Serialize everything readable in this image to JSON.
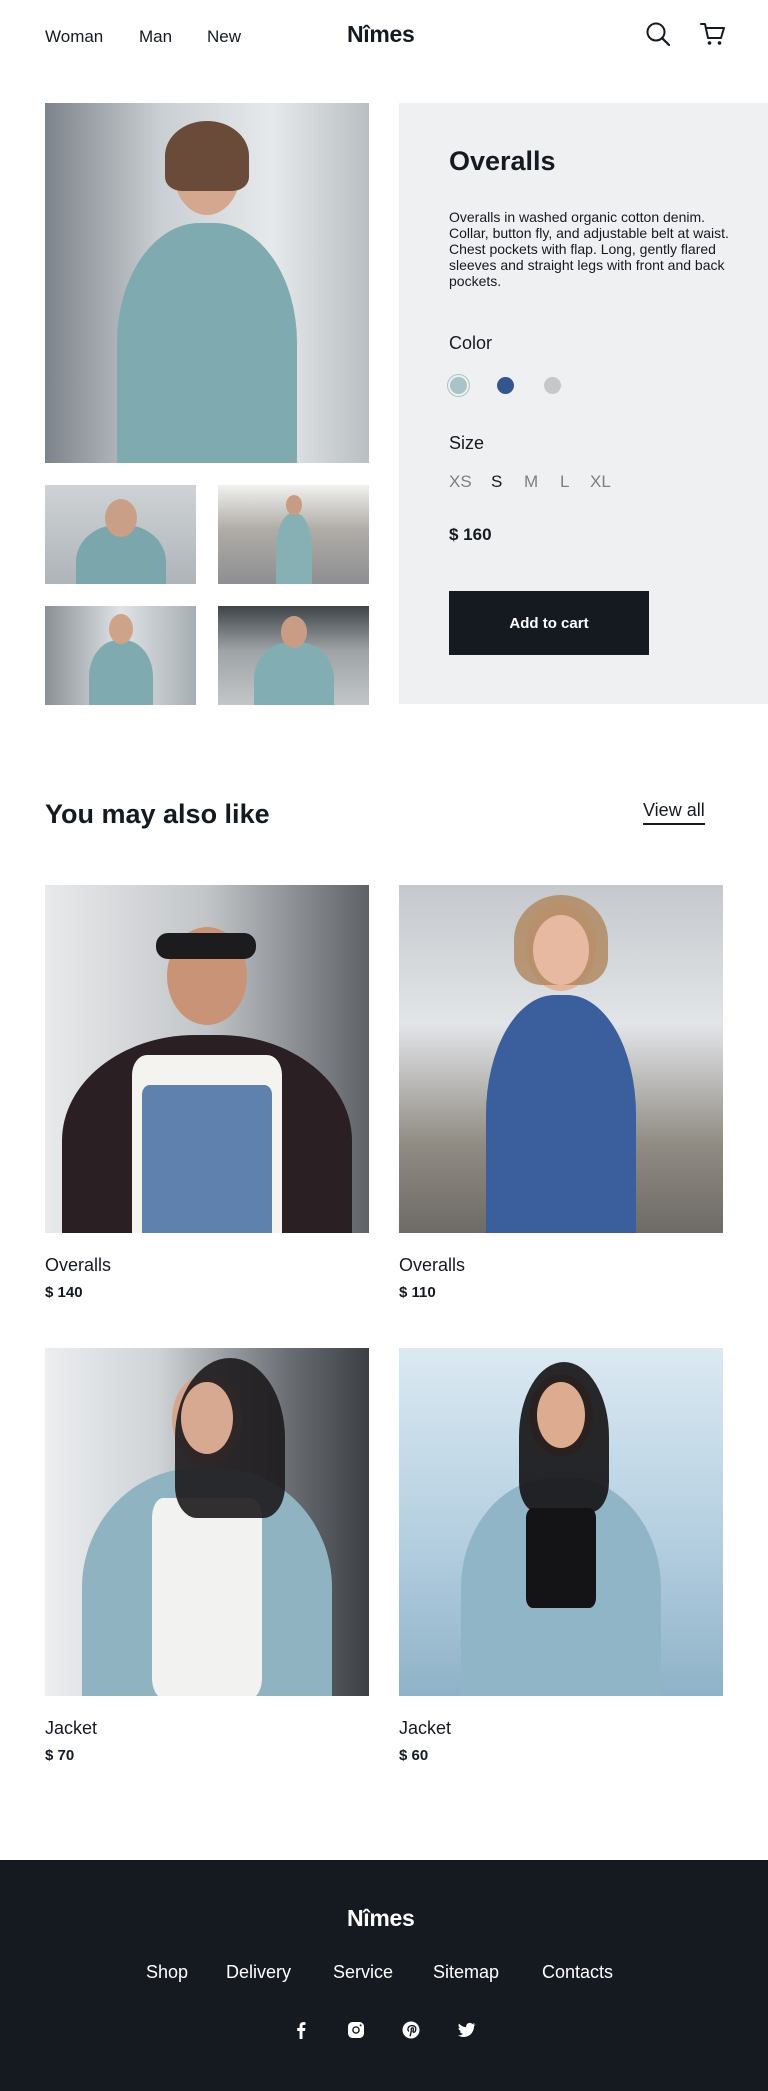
{
  "header": {
    "nav": [
      {
        "label": "Woman"
      },
      {
        "label": "Man"
      },
      {
        "label": "New"
      }
    ],
    "logo": "Nîmes",
    "icons": [
      "search-icon",
      "cart-icon"
    ]
  },
  "product": {
    "title": "Overalls",
    "description": "Overalls in washed organic cotton denim. Collar, button fly, and adjustable belt at waist. Chest pockets with flap. Long, gently flared sleeves and straight legs with front and back pockets.",
    "color_label": "Color",
    "colors": [
      "#a9c3c6",
      "#33568e",
      "#c5c7c9"
    ],
    "selected_color": 0,
    "size_label": "Size",
    "sizes": [
      "XS",
      "S",
      "M",
      "L",
      "XL"
    ],
    "selected_size": "S",
    "price": "$ 160",
    "cta": "Add to cart"
  },
  "related": {
    "title": "You may also like",
    "view_all": "View all",
    "items": [
      {
        "name": "Overalls",
        "price": "$ 140"
      },
      {
        "name": "Overalls",
        "price": "$ 110"
      },
      {
        "name": "Jacket",
        "price": "$ 70"
      },
      {
        "name": "Jacket",
        "price": "$ 60"
      }
    ]
  },
  "footer": {
    "logo": "Nîmes",
    "links": [
      "Shop",
      "Delivery",
      "Service",
      "Sitemap",
      "Contacts"
    ],
    "social": [
      "facebook-icon",
      "instagram-icon",
      "pinterest-icon",
      "twitter-icon"
    ]
  }
}
